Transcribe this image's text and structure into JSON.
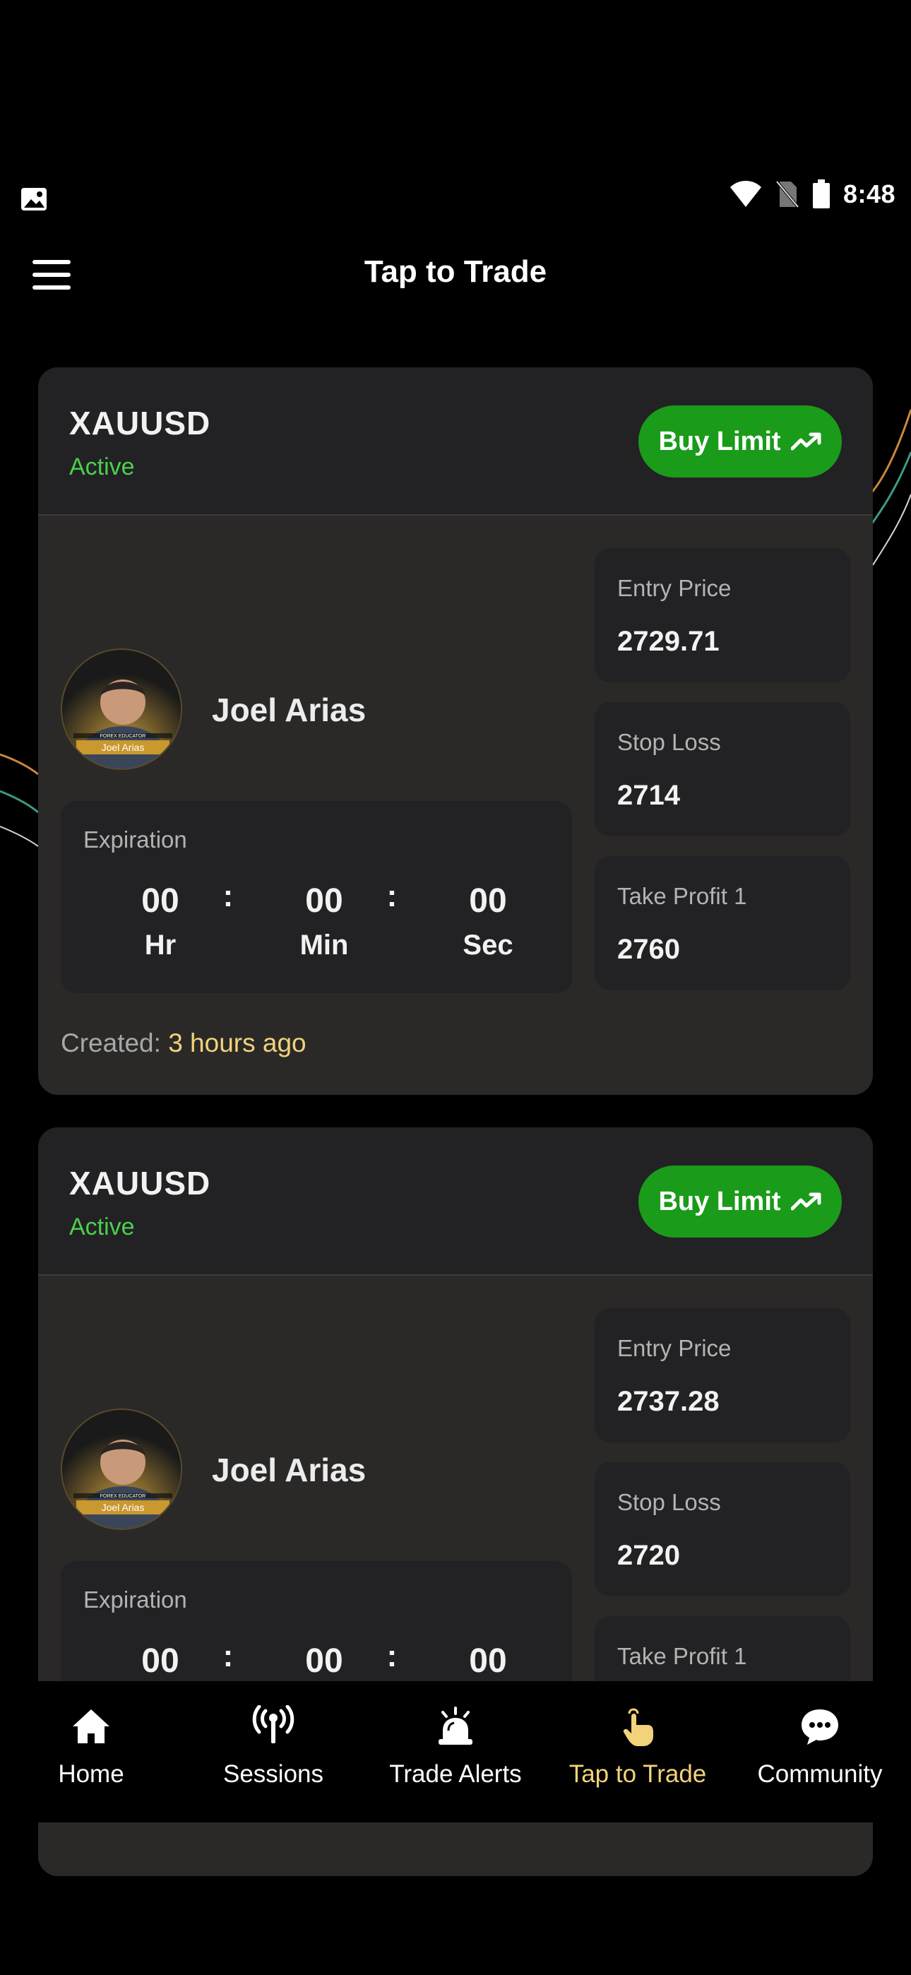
{
  "status_bar": {
    "time": "8:48"
  },
  "header": {
    "title": "Tap to Trade"
  },
  "trades": [
    {
      "symbol": "XAUUSD",
      "status": "Active",
      "action_label": "Buy Limit",
      "trader_name": "Joel Arias",
      "avatar_caption_top": "FOREX EDUCATOR",
      "avatar_caption_name": "Joel Arias",
      "expiration": {
        "label": "Expiration",
        "hours": "00",
        "minutes": "00",
        "seconds": "00",
        "hours_unit": "Hr",
        "minutes_unit": "Min",
        "seconds_unit": "Sec",
        "separator": ":"
      },
      "prices": [
        {
          "label": "Entry Price",
          "value": "2729.71"
        },
        {
          "label": "Stop Loss",
          "value": "2714"
        },
        {
          "label": "Take Profit 1",
          "value": "2760"
        }
      ],
      "created_label": "Created:",
      "created_time": "3 hours ago"
    },
    {
      "symbol": "XAUUSD",
      "status": "Active",
      "action_label": "Buy Limit",
      "trader_name": "Joel Arias",
      "avatar_caption_top": "FOREX EDUCATOR",
      "avatar_caption_name": "Joel Arias",
      "expiration": {
        "label": "Expiration",
        "hours": "00",
        "minutes": "00",
        "seconds": "00",
        "separator": ":"
      },
      "prices": [
        {
          "label": "Entry Price",
          "value": "2737.28"
        },
        {
          "label": "Stop Loss",
          "value": "2720"
        },
        {
          "label": "Take Profit 1",
          "value": ""
        }
      ]
    }
  ],
  "bottom_nav": {
    "items": [
      {
        "label": "Home",
        "icon": "home-icon"
      },
      {
        "label": "Sessions",
        "icon": "broadcast-icon"
      },
      {
        "label": "Trade Alerts",
        "icon": "alarm-bell-icon"
      },
      {
        "label": "Tap to Trade",
        "icon": "tap-hand-icon",
        "active": true
      },
      {
        "label": "Community",
        "icon": "chat-bubble-icon"
      }
    ]
  },
  "colors": {
    "background": "#000000",
    "card": "#2a2928",
    "card_header": "#222224",
    "active_green": "#4cd04c",
    "buy_button": "#1a9b1a",
    "accent_gold": "#f2d27a"
  }
}
